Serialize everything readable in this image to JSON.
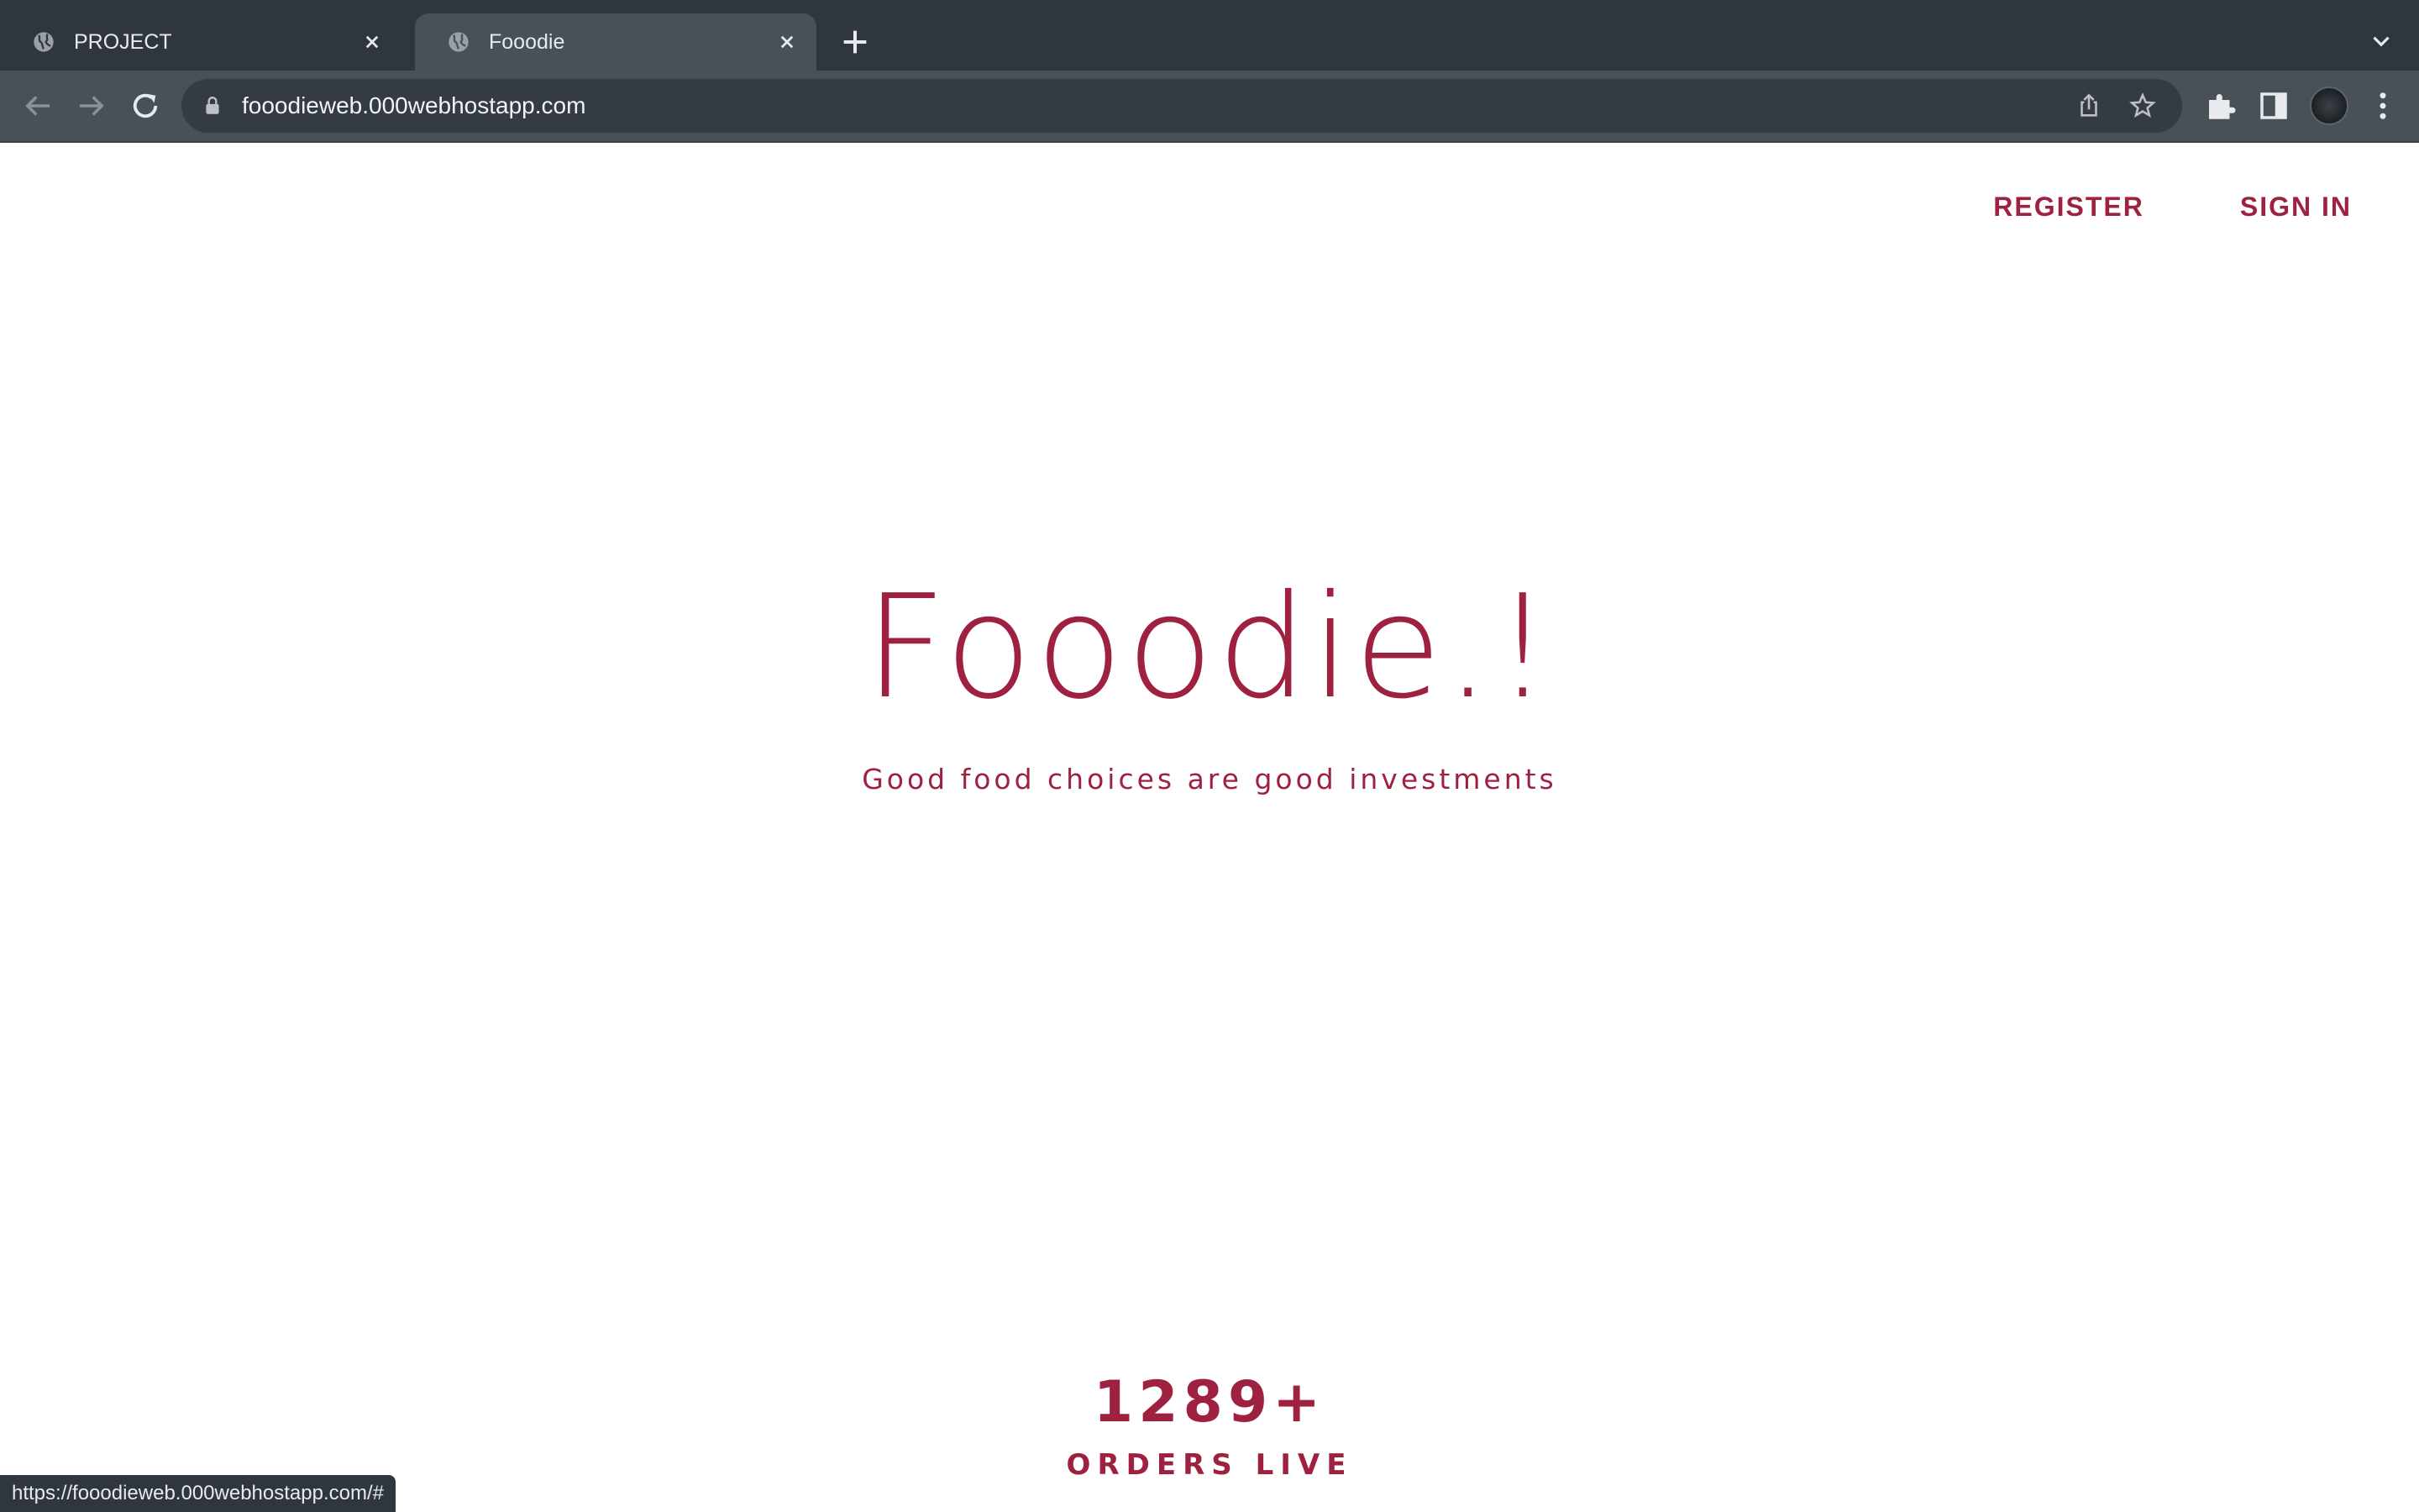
{
  "browser": {
    "tabs": [
      {
        "title": "PROJECT",
        "active": false,
        "icon": "globe-icon"
      },
      {
        "title": "Fooodie",
        "active": true,
        "icon": "globe-icon"
      }
    ],
    "address_bar": {
      "url": "fooodieweb.000webhostapp.com"
    },
    "status_url": "https://fooodieweb.000webhostapp.com/#",
    "colors": {
      "tabstrip": "#2f363d",
      "toolbar": "#485058",
      "omnibox": "#343b42"
    }
  },
  "page": {
    "nav": {
      "register_label": "REGISTER",
      "signin_label": "SIGN IN"
    },
    "hero": {
      "title": "Fooodie.!",
      "subtitle": "Good food choices are good investments"
    },
    "stat": {
      "value": "1289+",
      "label": "ORDERS LIVE"
    },
    "colors": {
      "accent": "#9e2140",
      "background": "#ffffff"
    }
  }
}
